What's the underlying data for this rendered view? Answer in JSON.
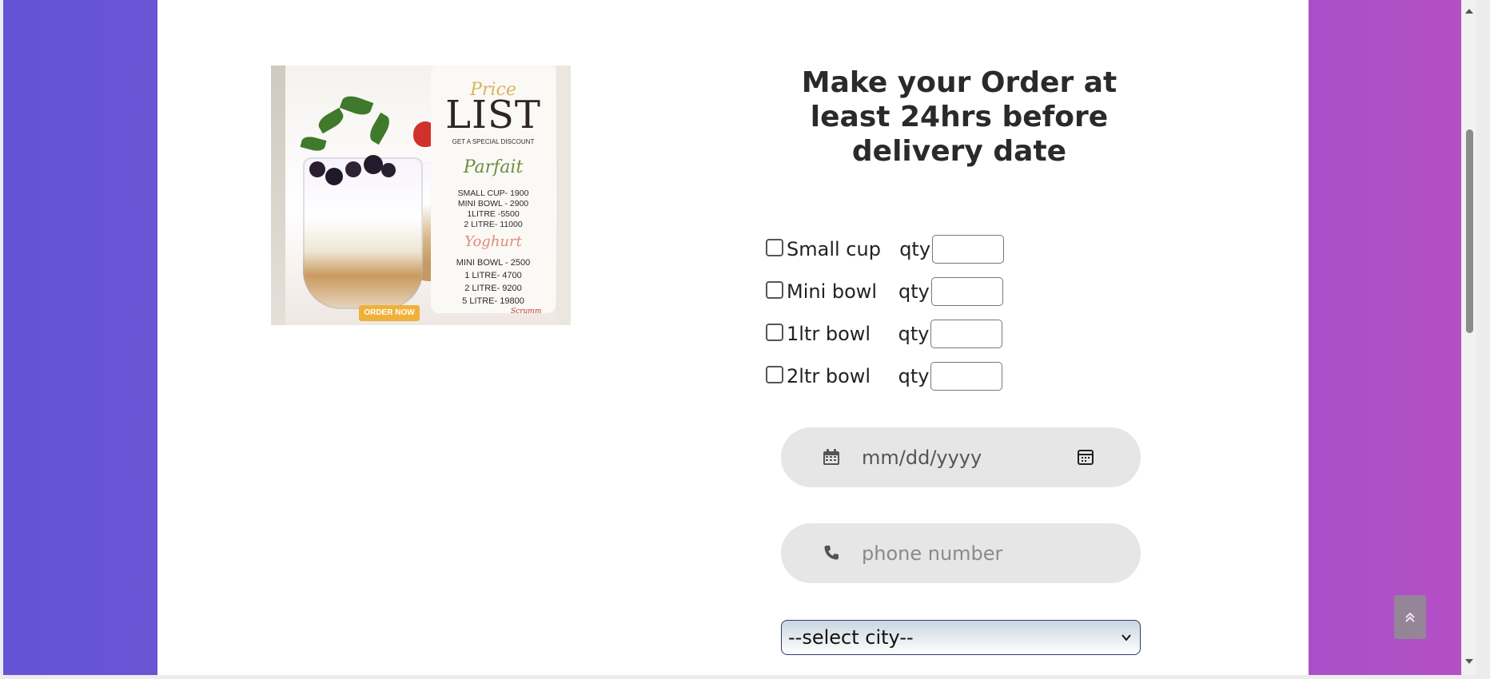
{
  "promo": {
    "script_title": "Price",
    "title": "LIST",
    "discount": "GET A SPECIAL DISCOUNT",
    "parfait_heading": "Parfait",
    "parfait_items": [
      "SMALL CUP- 1900",
      "MINI BOWL - 2900",
      "1LITRE -5500",
      "2 LITRE- 11000"
    ],
    "yoghurt_heading": "Yoghurt",
    "yoghurt_items": [
      "MINI BOWL - 2500",
      "1 LITRE- 4700",
      "2 LITRE- 9200",
      "5 LITRE- 19800"
    ],
    "order_now": "ORDER NOW",
    "brand": "Scrumm"
  },
  "title": "Make your Order at least 24hrs before delivery date",
  "products": [
    {
      "label": "Small cup",
      "qty_label": "  qty",
      "checked": false,
      "qty": ""
    },
    {
      "label": "Mini bowl",
      "qty_label": "   qty",
      "checked": false,
      "qty": ""
    },
    {
      "label": "1ltr bowl",
      "qty_label": "    qty",
      "checked": false,
      "qty": ""
    },
    {
      "label": "2ltr bowl",
      "qty_label": "    qty",
      "checked": false,
      "qty": ""
    }
  ],
  "date_input": {
    "placeholder": "mm/dd/yyyy"
  },
  "phone_input": {
    "placeholder": "phone number"
  },
  "city_select": {
    "selected": "--select city--"
  },
  "colors": {
    "gradient_left": "#6453d6",
    "gradient_right": "#b44fc6",
    "input_bg": "#e6e6e6",
    "title_color": "#2a2a2a"
  }
}
